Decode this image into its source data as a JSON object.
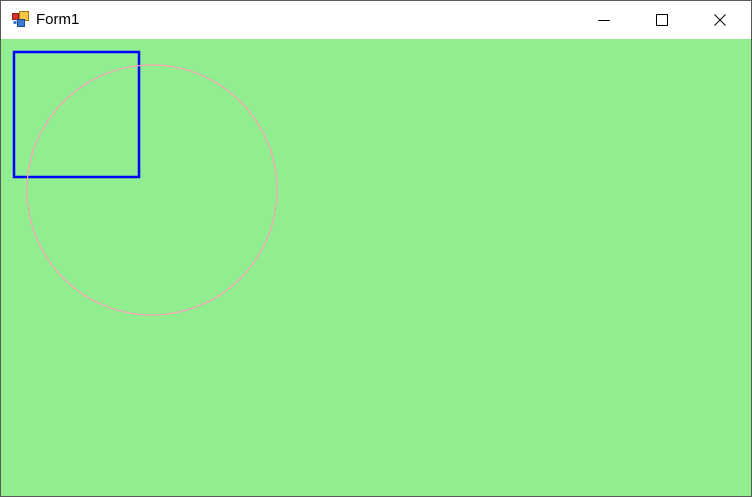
{
  "window": {
    "title": "Form1",
    "client_background": "#90ee90"
  },
  "caption_buttons": {
    "minimize": "minimize-icon",
    "maximize": "maximize-icon",
    "close": "close-icon"
  },
  "drawing": {
    "shapes": [
      {
        "kind": "rectangle",
        "stroke": "#0000ff"
      },
      {
        "kind": "ellipse",
        "stroke": "#ff9fb8"
      }
    ]
  }
}
